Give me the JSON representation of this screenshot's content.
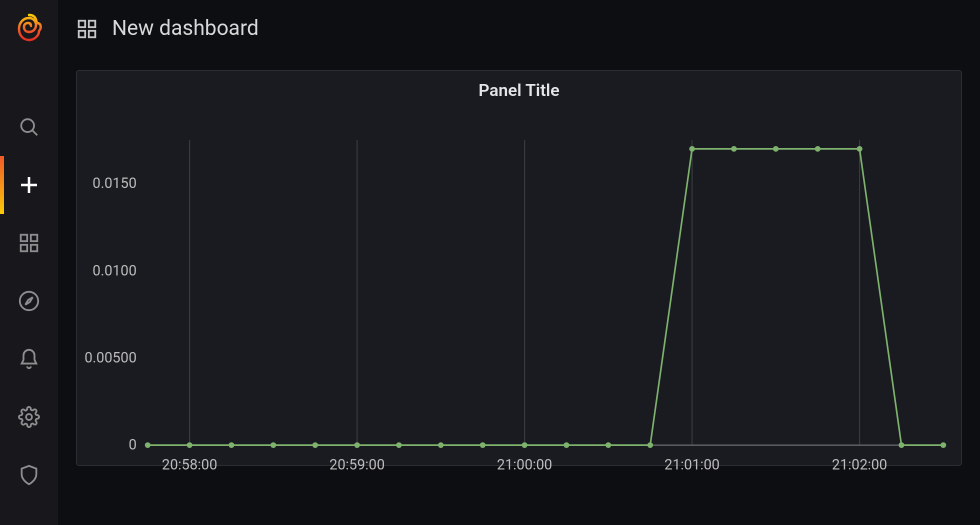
{
  "header": {
    "title": "New dashboard"
  },
  "sidebar": {
    "items": [
      {
        "name": "search-icon",
        "active": false
      },
      {
        "name": "plus-icon",
        "active": true
      },
      {
        "name": "apps-icon",
        "active": false
      },
      {
        "name": "compass-icon",
        "active": false
      },
      {
        "name": "bell-icon",
        "active": false
      },
      {
        "name": "gear-icon",
        "active": false
      },
      {
        "name": "shield-icon",
        "active": false
      }
    ]
  },
  "panel": {
    "title": "Panel Title"
  },
  "chart_data": {
    "type": "line",
    "title": "Panel Title",
    "xlabel": "",
    "ylabel": "",
    "x_ticks_major": [
      "20:58:00",
      "20:59:00",
      "21:00:00",
      "21:01:00",
      "21:02:00"
    ],
    "y_ticks": [
      0,
      0.005,
      0.01,
      0.015
    ],
    "y_tick_labels": [
      "0",
      "0.00500",
      "0.0100",
      "0.0150"
    ],
    "ylim": [
      0,
      0.0175
    ],
    "categories": [
      "20:57:45",
      "20:58:00",
      "20:58:15",
      "20:58:30",
      "20:58:45",
      "20:59:00",
      "20:59:15",
      "20:59:30",
      "20:59:45",
      "21:00:00",
      "21:00:15",
      "21:00:30",
      "21:00:45",
      "21:01:00",
      "21:01:15",
      "21:01:30",
      "21:01:45",
      "21:02:00",
      "21:02:15",
      "21:02:30"
    ],
    "values": [
      0,
      0,
      0,
      0,
      0,
      0,
      0,
      0,
      0,
      0,
      0,
      0,
      0,
      0.017,
      0.017,
      0.017,
      0.017,
      0.017,
      0,
      0
    ],
    "series_color": "#7eb26d"
  }
}
